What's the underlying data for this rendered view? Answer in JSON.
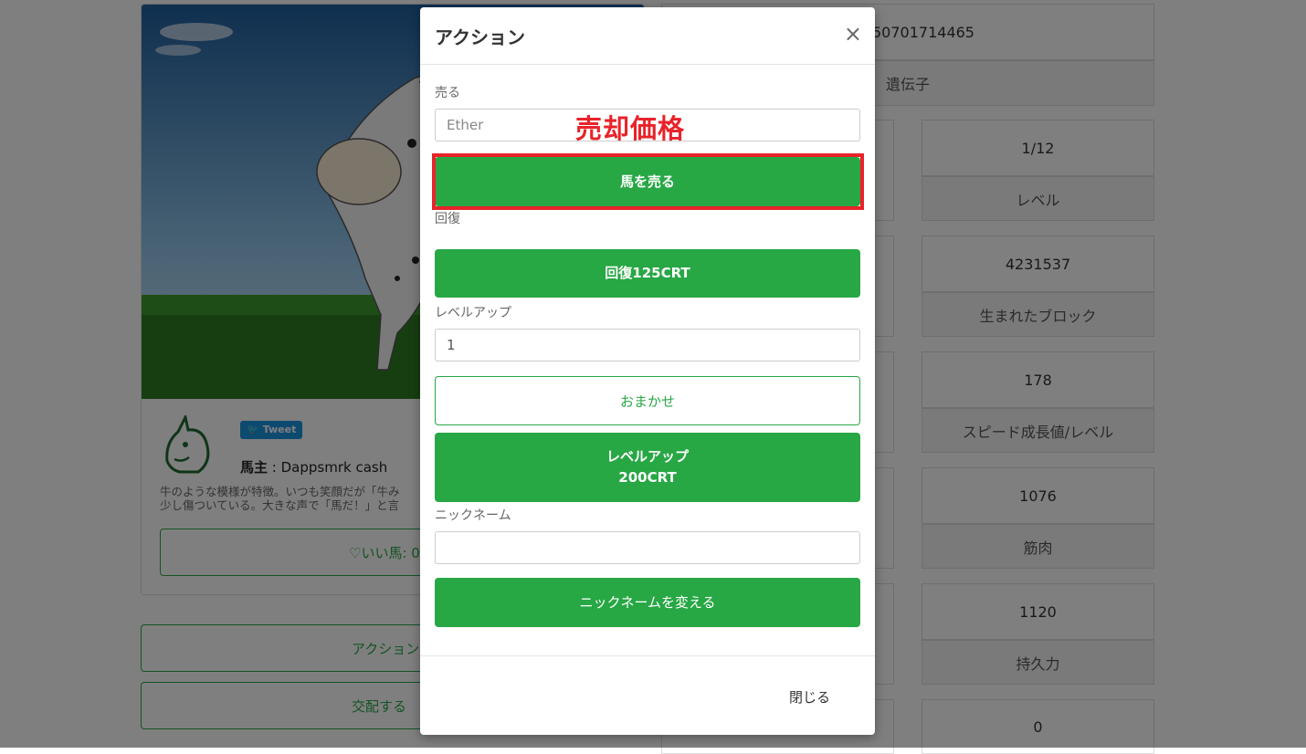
{
  "horse": {
    "tweet_label": "Tweet",
    "owner_label": "馬主",
    "owner_name": "Dappsmrk cash",
    "description_line1": "牛のような模様が特徴。いつも笑顔だが「牛み",
    "description_line2": "少し傷ついている。大きな声で「馬だ！」と言",
    "like_label": "♡いい馬: 0"
  },
  "side_buttons": {
    "action_label": "アクション",
    "breed_label": "交配する"
  },
  "stats": {
    "id_value": "50701714465",
    "gene_label": "遺伝子",
    "rows": [
      {
        "value": "1/12",
        "label": "レベル"
      },
      {
        "value": "4231537",
        "label": "生まれたブロック"
      },
      {
        "value": "178",
        "label": "スピード成長値/レベル"
      },
      {
        "value": "1076",
        "label": "筋肉"
      },
      {
        "value": "1120",
        "label": "持久力"
      },
      {
        "value": "0",
        "label": ""
      }
    ]
  },
  "modal": {
    "title": "アクション",
    "close_icon": "×",
    "sell": {
      "label": "売る",
      "placeholder": "Ether",
      "annotation": "売却価格",
      "button": "馬を売る"
    },
    "recover": {
      "label": "回復",
      "button": "回復125CRT"
    },
    "levelup": {
      "label": "レベルアップ",
      "value": "1",
      "auto_button": "おまかせ",
      "button_line1": "レベルアップ",
      "button_line2": "200CRT"
    },
    "nickname": {
      "label": "ニックネーム",
      "value": "",
      "button": "ニックネームを変える"
    },
    "footer_close": "閉じる"
  },
  "colors": {
    "primary_green": "#28a745",
    "annotation_red": "#e8232a",
    "overlay": "rgba(0,0,0,0.5)"
  }
}
